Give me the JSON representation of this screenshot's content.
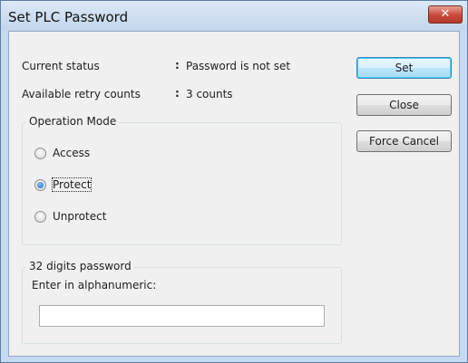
{
  "window": {
    "title": "Set PLC Password",
    "close_glyph": "✕"
  },
  "status": {
    "current_status_label": "Current status",
    "current_status_sep": ":",
    "current_status_value": "Password is not set",
    "retry_label": "Available retry counts",
    "retry_sep": ":",
    "retry_value": "3 counts"
  },
  "buttons": {
    "set": "Set",
    "close": "Close",
    "force_cancel": "Force Cancel"
  },
  "operation_mode": {
    "title": "Operation Mode",
    "options": [
      {
        "label": "Access",
        "checked": false
      },
      {
        "label": "Protect",
        "checked": true
      },
      {
        "label": "Unprotect",
        "checked": false
      }
    ]
  },
  "password": {
    "group_title": "32 digits password",
    "prompt": "Enter in alphanumeric:",
    "value": ""
  },
  "colors": {
    "title_bar": "#c3d6ec",
    "close_button": "#c8493a",
    "dialog_background": "#f0f0f0",
    "default_button_border": "#3c7fb1"
  }
}
